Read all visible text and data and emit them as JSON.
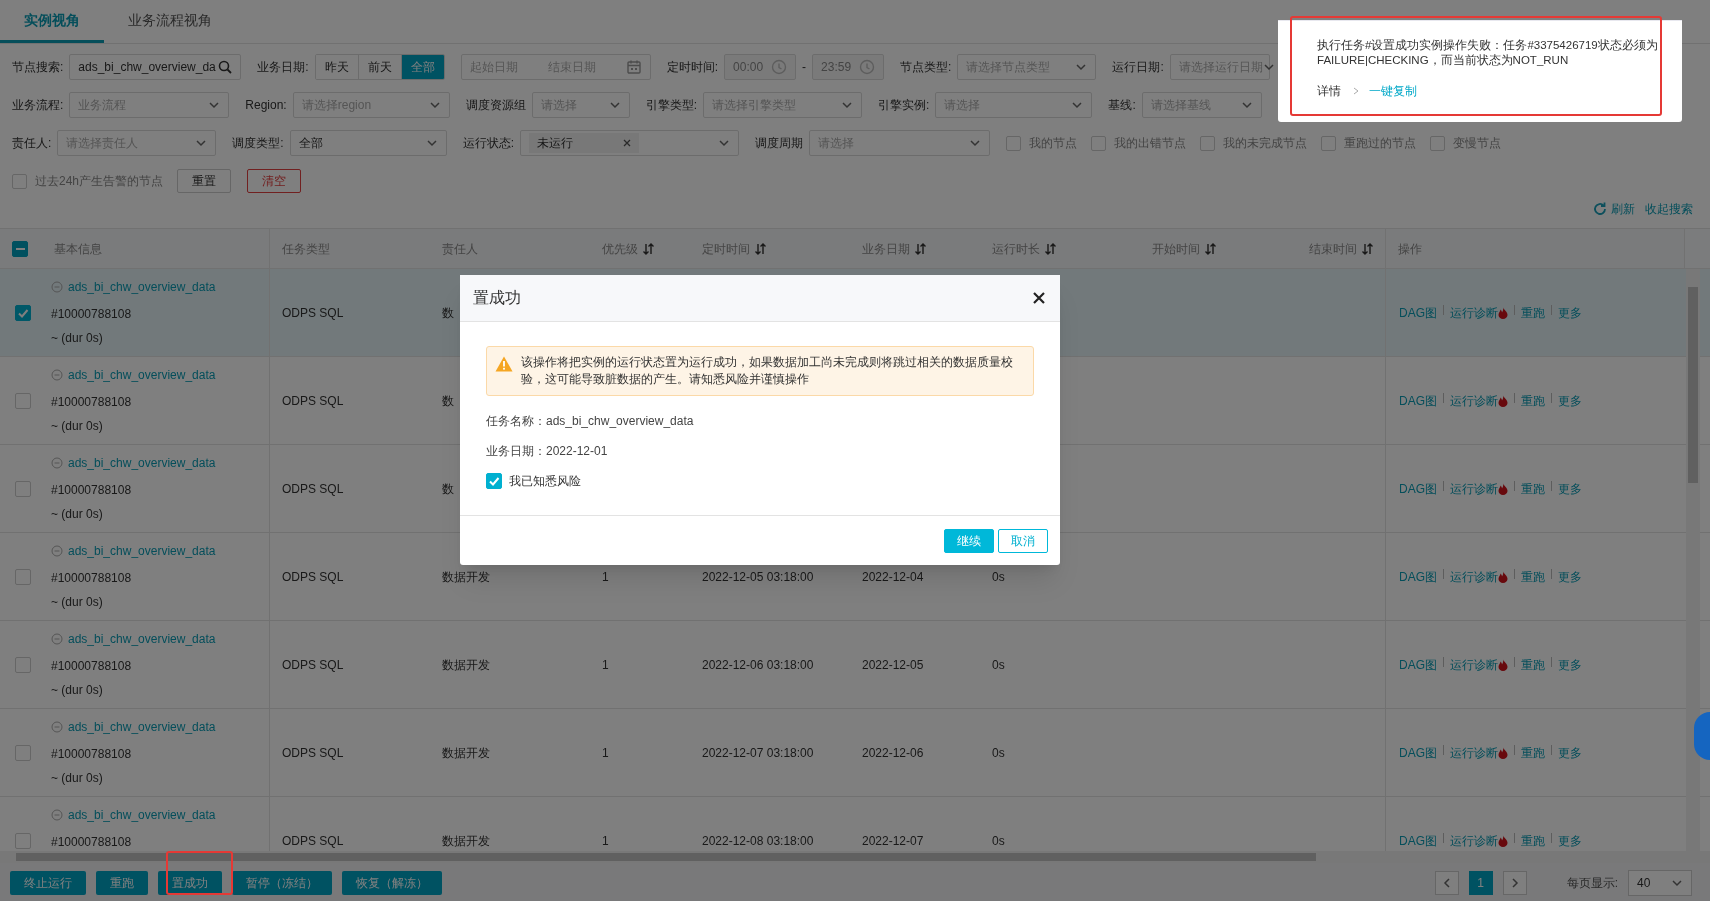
{
  "tabs": [
    {
      "label": "实例视角",
      "selected": true
    },
    {
      "label": "业务流程视角",
      "selected": false
    }
  ],
  "filter_rows": [
    {
      "items": [
        {
          "kind": "input",
          "label": "节点搜索:",
          "value": "ads_bi_chw_overview_da"
        },
        {
          "kind": "segmented",
          "label": "业务日期:",
          "options": [
            {
              "label": "昨天",
              "selected": false
            },
            {
              "label": "前天",
              "selected": false
            },
            {
              "label": "全部",
              "selected": true
            }
          ]
        },
        {
          "kind": "daterange",
          "start_placeholder": "起始日期",
          "end_placeholder": "结束日期"
        },
        {
          "kind": "timerange",
          "label": "定时时间:",
          "start": "00:00",
          "separator": "-",
          "end": "23:59"
        },
        {
          "kind": "select",
          "label": "节点类型:",
          "placeholder": "请选择节点类型"
        },
        {
          "kind": "select",
          "label": "运行日期:",
          "placeholder": "请选择运行日期"
        }
      ]
    },
    {
      "items": [
        {
          "kind": "select",
          "label": "业务流程:",
          "placeholder": "业务流程"
        },
        {
          "kind": "select",
          "label": "Region:",
          "placeholder": "请选择region"
        },
        {
          "kind": "select",
          "label": "调度资源组",
          "placeholder": "请选择"
        },
        {
          "kind": "select",
          "label": "引擎类型:",
          "placeholder": "请选择引擎类型"
        },
        {
          "kind": "select",
          "label": "引擎实例:",
          "placeholder": "请选择"
        },
        {
          "kind": "select",
          "label": "基线:",
          "placeholder": "请选择基线"
        }
      ]
    },
    {
      "items": [
        {
          "kind": "select",
          "label": "责任人:",
          "placeholder": "请选择责任人"
        },
        {
          "kind": "select",
          "label": "调度类型:",
          "value": "全部"
        },
        {
          "kind": "tagselect",
          "label": "运行状态:",
          "tags": [
            "未运行"
          ]
        },
        {
          "kind": "select",
          "label": "调度周期",
          "placeholder": "请选择"
        },
        {
          "kind": "checkbox",
          "label": "我的节点",
          "checked": false
        },
        {
          "kind": "checkbox",
          "label": "我的出错节点",
          "checked": false
        },
        {
          "kind": "checkbox",
          "label": "我的未完成节点",
          "checked": false
        },
        {
          "kind": "checkbox",
          "label": "重跑过的节点",
          "checked": false
        },
        {
          "kind": "checkbox",
          "label": "变慢节点",
          "checked": false
        }
      ]
    },
    {
      "items": [
        {
          "kind": "checkbox",
          "label": "过去24h产生告警的节点",
          "checked": false
        },
        {
          "kind": "button",
          "label": "重置"
        },
        {
          "kind": "danger_button",
          "label": "清空"
        }
      ]
    }
  ],
  "search_links": [
    {
      "kind": "refresh",
      "label": "刷新"
    },
    {
      "kind": "link",
      "label": "收起搜索"
    }
  ],
  "table": {
    "header_checkbox": {
      "indeterminate": true
    },
    "columns": [
      {
        "label": "基本信息",
        "sortable": false
      },
      {
        "label": "任务类型",
        "sortable": false
      },
      {
        "label": "责任人",
        "sortable": false
      },
      {
        "label": "优先级",
        "sortable": true
      },
      {
        "label": "定时时间",
        "sortable": true
      },
      {
        "label": "业务日期",
        "sortable": true
      },
      {
        "label": "运行时长",
        "sortable": true
      },
      {
        "label": "开始时间",
        "sortable": true
      },
      {
        "label": "结束时间",
        "sortable": true
      },
      {
        "label": "操作",
        "sortable": false
      }
    ],
    "rows": [
      {
        "selected": true,
        "name": "ads_bi_chw_overview_data",
        "id": "#10000788108",
        "duration": "~ (dur 0s)",
        "type": "ODPS SQL",
        "owner": "数",
        "actions": [
          {
            "label": "DAG图",
            "hot": false
          },
          {
            "label": "运行诊断",
            "hot": true
          },
          {
            "label": "重跑",
            "hot": false
          },
          {
            "label": "更多",
            "hot": false
          }
        ]
      },
      {
        "selected": false,
        "name": "ads_bi_chw_overview_data",
        "id": "#10000788108",
        "duration": "~ (dur 0s)",
        "type": "ODPS SQL",
        "owner": "数",
        "actions": [
          {
            "label": "DAG图",
            "hot": false
          },
          {
            "label": "运行诊断",
            "hot": true
          },
          {
            "label": "重跑",
            "hot": false
          },
          {
            "label": "更多",
            "hot": false
          }
        ]
      },
      {
        "selected": false,
        "name": "ads_bi_chw_overview_data",
        "id": "#10000788108",
        "duration": "~ (dur 0s)",
        "type": "ODPS SQL",
        "owner": "数",
        "actions": [
          {
            "label": "DAG图",
            "hot": false
          },
          {
            "label": "运行诊断",
            "hot": true
          },
          {
            "label": "重跑",
            "hot": false
          },
          {
            "label": "更多",
            "hot": false
          }
        ]
      },
      {
        "selected": false,
        "name": "ads_bi_chw_overview_data",
        "id": "#10000788108",
        "duration": "~ (dur 0s)",
        "type": "ODPS SQL",
        "owner": "数据开发",
        "priority": "1",
        "schedule_time": "2022-12-05 03:18:00",
        "business_date": "2022-12-04",
        "run_duration": "0s",
        "actions": [
          {
            "label": "DAG图",
            "hot": false
          },
          {
            "label": "运行诊断",
            "hot": true
          },
          {
            "label": "重跑",
            "hot": false
          },
          {
            "label": "更多",
            "hot": false
          }
        ]
      },
      {
        "selected": false,
        "name": "ads_bi_chw_overview_data",
        "id": "#10000788108",
        "duration": "~ (dur 0s)",
        "type": "ODPS SQL",
        "owner": "数据开发",
        "priority": "1",
        "schedule_time": "2022-12-06 03:18:00",
        "business_date": "2022-12-05",
        "run_duration": "0s",
        "actions": [
          {
            "label": "DAG图",
            "hot": false
          },
          {
            "label": "运行诊断",
            "hot": true
          },
          {
            "label": "重跑",
            "hot": false
          },
          {
            "label": "更多",
            "hot": false
          }
        ]
      },
      {
        "selected": false,
        "name": "ads_bi_chw_overview_data",
        "id": "#10000788108",
        "duration": "~ (dur 0s)",
        "type": "ODPS SQL",
        "owner": "数据开发",
        "priority": "1",
        "schedule_time": "2022-12-07 03:18:00",
        "business_date": "2022-12-06",
        "run_duration": "0s",
        "actions": [
          {
            "label": "DAG图",
            "hot": false
          },
          {
            "label": "运行诊断",
            "hot": true
          },
          {
            "label": "重跑",
            "hot": false
          },
          {
            "label": "更多",
            "hot": false
          }
        ]
      },
      {
        "selected": false,
        "name": "ads_bi_chw_overview_data",
        "id": "#10000788108",
        "type": "ODPS SQL",
        "owner": "数据开发",
        "priority": "1",
        "schedule_time": "2022-12-08 03:18:00",
        "business_date": "2022-12-07",
        "run_duration": "0s",
        "actions": [
          {
            "label": "DAG图",
            "hot": false
          },
          {
            "label": "运行诊断",
            "hot": true
          },
          {
            "label": "重跑",
            "hot": false
          },
          {
            "label": "更多",
            "hot": false
          }
        ]
      }
    ]
  },
  "batch_actions": [
    "终止运行",
    "重跑",
    "置成功",
    "暂停（冻结）",
    "恢复（解冻）"
  ],
  "pagination": {
    "pages": [
      {
        "label": "1",
        "selected": true
      }
    ],
    "page_size_label": "每页显示:",
    "page_size": "40"
  },
  "dialog": {
    "title": "置成功",
    "warning": "该操作将把实例的运行状态置为运行成功，如果数据加工尚未完成则将跳过相关的数据质量校验，这可能导致脏数据的产生。请知悉风险并谨慎操作",
    "lines": [
      "任务名称：ads_bi_chw_overview_data",
      "业务日期：2022-12-01"
    ],
    "confirm": {
      "label": "我已知悉风险",
      "checked": true
    },
    "buttons": [
      {
        "kind": "primary",
        "label": "继续"
      },
      {
        "kind": "secondary",
        "label": "取消"
      }
    ]
  },
  "notification": {
    "message": "执行任务#设置成功实例操作失败：任务#3375426719状态必须为FAILURE|CHECKING，而当前状态为NOT_RUN",
    "links": [
      {
        "kind": "details",
        "label": "详情"
      },
      {
        "kind": "copy",
        "label": "一键复制"
      }
    ]
  }
}
